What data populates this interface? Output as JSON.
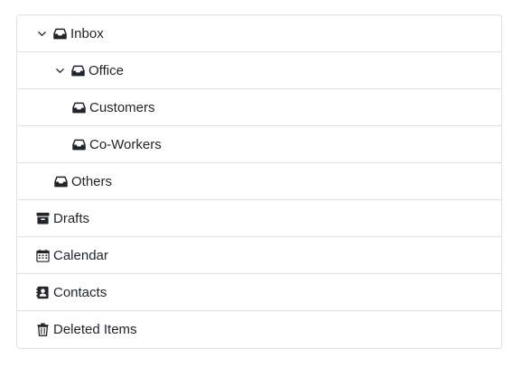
{
  "tree": {
    "items": [
      {
        "label": "Inbox",
        "icon": "inbox-icon",
        "expanded": true
      },
      {
        "label": "Office",
        "icon": "inbox-icon",
        "expanded": true
      },
      {
        "label": "Customers",
        "icon": "inbox-icon"
      },
      {
        "label": "Co-Workers",
        "icon": "inbox-icon"
      },
      {
        "label": "Others",
        "icon": "inbox-icon"
      },
      {
        "label": "Drafts",
        "icon": "archive-icon"
      },
      {
        "label": "Calendar",
        "icon": "calendar-icon"
      },
      {
        "label": "Contacts",
        "icon": "contacts-icon"
      },
      {
        "label": "Deleted Items",
        "icon": "trash-icon"
      }
    ]
  }
}
